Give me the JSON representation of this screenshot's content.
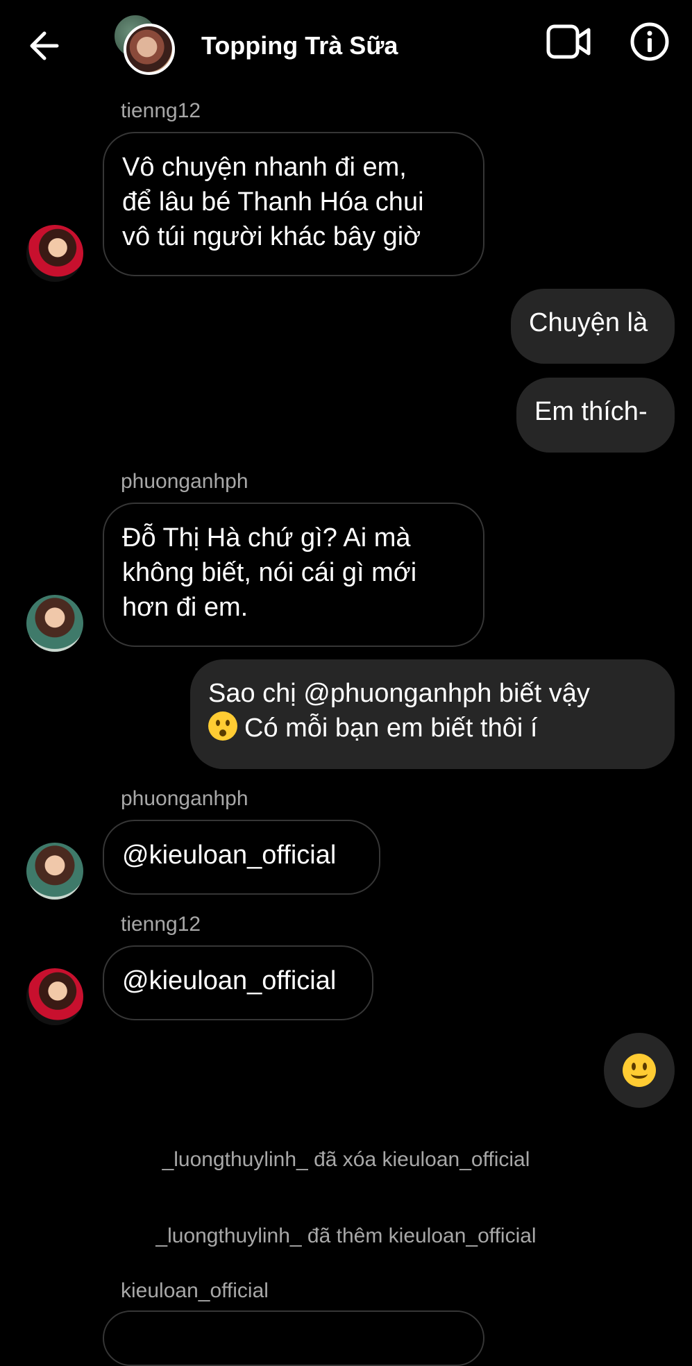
{
  "header": {
    "title": "Topping Trà Sữa",
    "back_icon": "arrow-left-icon",
    "video_icon": "video-camera-icon",
    "info_icon": "info-icon"
  },
  "messages": [
    {
      "type": "incoming",
      "sender": "tienng12",
      "lines": [
        "Vô chuyện nhanh đi em,",
        "để lâu bé Thanh Hóa chui",
        "vô túi người khác bây giờ"
      ]
    },
    {
      "type": "outgoing",
      "lines": [
        "Chuyện là"
      ]
    },
    {
      "type": "outgoing",
      "lines": [
        "Em thích-"
      ]
    },
    {
      "type": "incoming",
      "sender": "phuonganhph",
      "lines": [
        "Đỗ Thị Hà chứ gì? Ai mà",
        "không biết, nói cái gì mới",
        "hơn đi em."
      ]
    },
    {
      "type": "outgoing",
      "lines": [
        "Sao chị @phuonganhph biết vậy",
        "Có mỗi bạn em biết thôi í"
      ],
      "emoji": "hushed-face-emoji"
    },
    {
      "type": "incoming",
      "sender": "phuonganhph",
      "lines": [
        "@kieuloan_official"
      ]
    },
    {
      "type": "incoming",
      "sender": "tienng12",
      "lines": [
        "@kieuloan_official"
      ]
    },
    {
      "type": "outgoing-reaction",
      "emoji": "slightly-smiling-face-emoji"
    }
  ],
  "system_messages": [
    "_luongthuylinh_ đã xóa kieuloan_official",
    "_luongthuylinh_ đã thêm kieuloan_official"
  ],
  "last_sender": "kieuloan_official",
  "colors": {
    "background": "#000000",
    "outgoing_bubble": "#262626",
    "incoming_border": "#363636",
    "secondary_text": "#a8a8a8"
  }
}
